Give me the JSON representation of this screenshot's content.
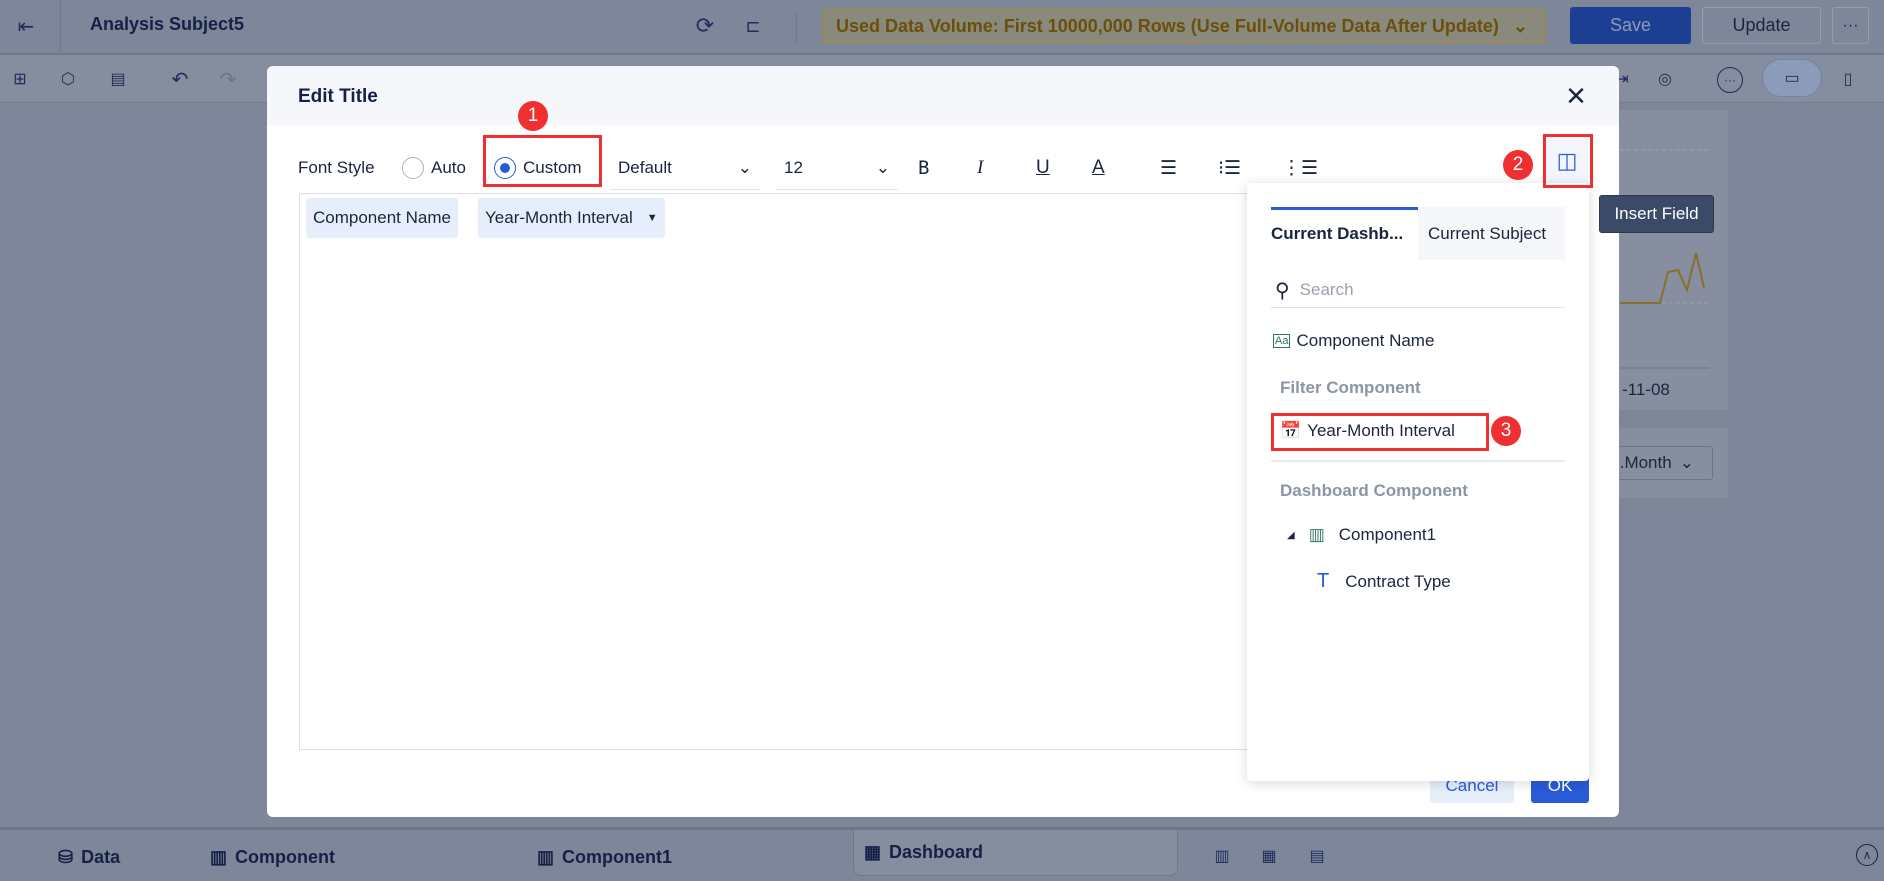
{
  "header": {
    "title": "Analysis Subject5",
    "data_volume": "Used Data Volume: First 10000,000 Rows (Use Full-Volume Data After Update)",
    "save": "Save",
    "update": "Update",
    "more": "···"
  },
  "background": {
    "axis_label": "-11-08",
    "dropdown": "..Month"
  },
  "bottom_tabs": [
    {
      "label": "Data"
    },
    {
      "label": "Component"
    },
    {
      "label": "Component1"
    },
    {
      "label": "Dashboard"
    }
  ],
  "dialog": {
    "title": "Edit Title",
    "font_style_label": "Font Style",
    "radio_auto": "Auto",
    "radio_custom": "Custom",
    "font_family": "Default",
    "font_size": "12",
    "format": {
      "bold": "B",
      "italic": "I",
      "underline": "U",
      "color": "A"
    },
    "chips": [
      {
        "label": "Component Name"
      },
      {
        "label": "Year-Month Interval"
      }
    ],
    "cancel": "Cancel",
    "ok": "OK"
  },
  "insert_field": {
    "tooltip": "Insert Field",
    "tabs": [
      "Current Dashb...",
      "Current Subject"
    ],
    "search_placeholder": "Search",
    "component_name": "Component Name",
    "filter_group": "Filter Component",
    "filter_item": "Year-Month Interval",
    "dashboard_group": "Dashboard Component",
    "component1": "Component1",
    "contract_type": "Contract Type"
  },
  "annotations": [
    "1",
    "2",
    "3"
  ],
  "colors": {
    "accent": "#2a5bd7",
    "highlight": "#ee3030",
    "overlay": "#7e879a"
  }
}
